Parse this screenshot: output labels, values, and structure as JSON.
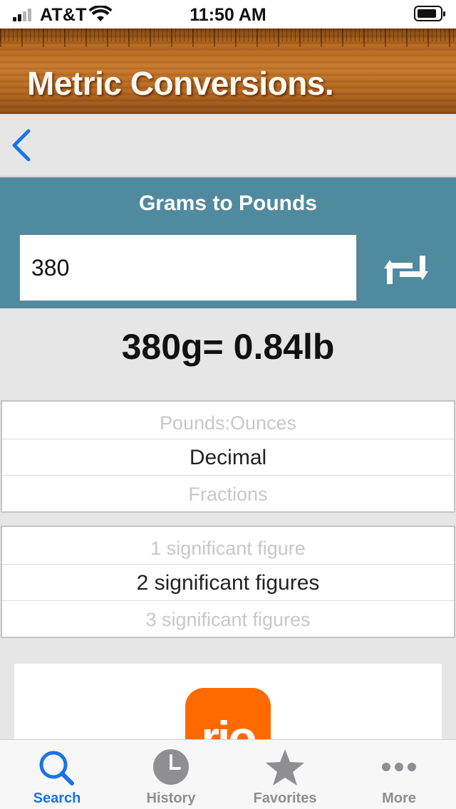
{
  "status_bar": {
    "carrier": "AT&T",
    "time": "11:50 AM"
  },
  "banner": {
    "title": "Metric Conversions."
  },
  "nav": {
    "back_icon": "chevron-left-icon"
  },
  "converter": {
    "title": "Grams to Pounds",
    "input_value": "380",
    "swap_icon": "swap-arrows-icon",
    "result": "380g= 0.84lb"
  },
  "format_picker": {
    "above": "Pounds:Ounces",
    "selected": "Decimal",
    "below": "Fractions"
  },
  "precision_picker": {
    "above": "1 significant figure",
    "selected": "2 significant figures",
    "below": "3 significant figures"
  },
  "ad": {
    "icon_text": "rio"
  },
  "tab_bar": {
    "tabs": [
      {
        "label": "Search",
        "icon": "search-icon",
        "active": true
      },
      {
        "label": "History",
        "icon": "clock-icon",
        "active": false
      },
      {
        "label": "Favorites",
        "icon": "star-icon",
        "active": false
      },
      {
        "label": "More",
        "icon": "more-icon",
        "active": false
      }
    ]
  },
  "colors": {
    "accent": "#1a73e8",
    "panel": "#4f8a9e",
    "inactive_tab": "#8e8e93"
  }
}
